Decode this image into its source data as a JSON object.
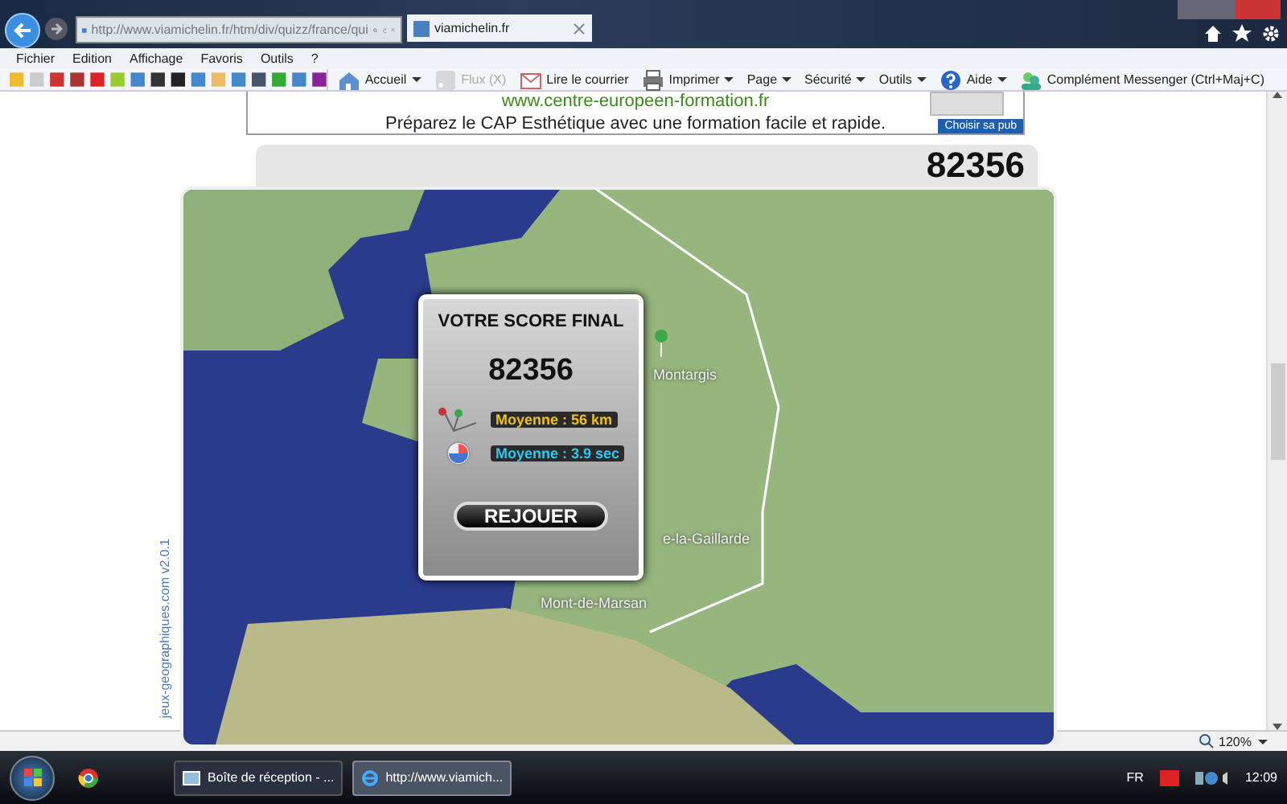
{
  "browser": {
    "address": "http://www.viamichelin.fr/htm/div/quizz/france/qui",
    "tab_title": "viamichelin.fr",
    "menu": [
      "Fichier",
      "Edition",
      "Affichage",
      "Favoris",
      "Outils",
      "?"
    ],
    "command_bar": [
      {
        "kind": "home",
        "label": "Accueil",
        "dropdown": true,
        "disabled": false
      },
      {
        "kind": "feed",
        "label": "Flux (X)",
        "dropdown": false,
        "disabled": true
      },
      {
        "kind": "mail",
        "label": "Lire le courrier",
        "dropdown": false,
        "disabled": false
      },
      {
        "kind": "print",
        "label": "Imprimer",
        "dropdown": true,
        "disabled": false
      },
      {
        "kind": "none",
        "label": "Page",
        "dropdown": true,
        "disabled": false
      },
      {
        "kind": "none",
        "label": "Sécurité",
        "dropdown": true,
        "disabled": false
      },
      {
        "kind": "none",
        "label": "Outils",
        "dropdown": true,
        "disabled": false
      },
      {
        "kind": "help",
        "label": "Aide",
        "dropdown": true,
        "disabled": false
      },
      {
        "kind": "messenger",
        "label": "Complément Messenger (Ctrl+Maj+C)",
        "dropdown": false,
        "disabled": false
      }
    ]
  },
  "ad": {
    "url": "www.centre-europeen-formation.fr",
    "text": "Préparez le CAP Esthétique avec une formation facile et rapide.",
    "button": "Choisir sa pub"
  },
  "score_header": "82356",
  "map": {
    "credit": "jeux-geographiques.com v2.0.1",
    "labels": [
      "Montargis",
      "e-la-Gaillarde",
      "Mont-de-Marsan"
    ]
  },
  "dialog": {
    "title": "VOTRE SCORE FINAL",
    "score": "82356",
    "stats": [
      {
        "kind": "distance",
        "text": "Moyenne : 56 km"
      },
      {
        "kind": "time",
        "text": "Moyenne : 3.9 sec"
      }
    ],
    "button": "REJOUER"
  },
  "status_bar": {
    "zoom": "120%"
  },
  "taskbar": {
    "windows": [
      {
        "kind": "mail",
        "label": "Boîte de réception - ...",
        "selected": false
      },
      {
        "kind": "browser",
        "label": "http://www.viamich...",
        "selected": true
      }
    ],
    "language": "FR",
    "clock": "12:09"
  }
}
